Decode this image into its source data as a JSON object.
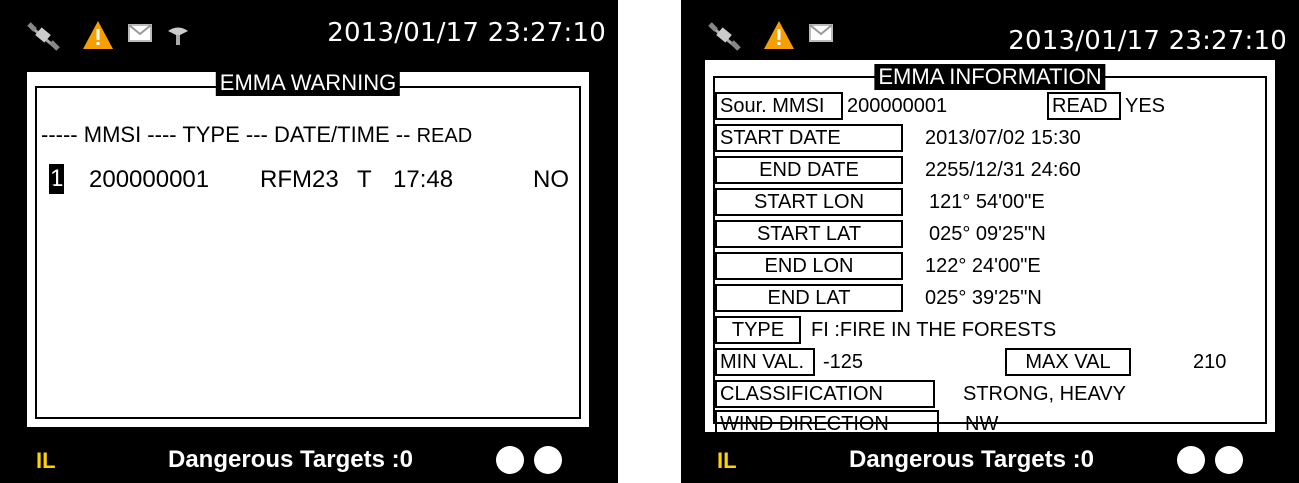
{
  "left": {
    "datetime": "2013/01/17 23:27:10",
    "title": "EMMA WARNING",
    "header": {
      "col_mmsi": "----- MMSI ---- TYPE --- DATE/TIME --",
      "col_read": "READ"
    },
    "rows": [
      {
        "index": "1",
        "sep": ".",
        "mmsi": "200000001",
        "type": "RFM23",
        "flag": "T",
        "time": "17:48",
        "read": "NO"
      }
    ],
    "bottom": {
      "il": "IL",
      "dangerous": "Dangerous Targets :0"
    }
  },
  "right": {
    "datetime": "2013/01/17 23:27:10",
    "title": "EMMA INFORMATION",
    "sour_mmsi_label": "Sour. MMSI",
    "sour_mmsi_value": "200000001",
    "read_label": "READ",
    "read_value": "YES",
    "start_date_label": "START  DATE",
    "start_date_value": "2013/07/02  15:30",
    "end_date_label": "END  DATE",
    "end_date_value": "2255/12/31   24:60",
    "start_lon_label": "START  LON",
    "start_lon_value": "121°  54'00\"E",
    "start_lat_label": "START  LAT",
    "start_lat_value": "025°  09'25\"N",
    "end_lon_label": "END  LON",
    "end_lon_value": "122°  24'00\"E",
    "end_lat_label": "END  LAT",
    "end_lat_value": "025°  39'25\"N",
    "type_label": "TYPE",
    "type_value": "FI :FIRE  IN  THE  FORESTS",
    "min_label": "MIN  VAL.",
    "min_value": "-125",
    "max_label": "MAX  VAL",
    "max_value": "210",
    "class_label": "CLASSIFICATION",
    "class_value": "STRONG,  HEAVY",
    "wind_label": "WIND  DIRECTION",
    "wind_value": "NW",
    "bottom": {
      "il": "IL",
      "dangerous": "Dangerous Targets :0"
    }
  },
  "icons": [
    "satellite-icon",
    "warning-icon",
    "mail-icon",
    "antenna-icon"
  ],
  "colors": {
    "il": "#ffd200",
    "warning": "#f5a000",
    "frame": "#000000",
    "panel": "#ffffff"
  }
}
